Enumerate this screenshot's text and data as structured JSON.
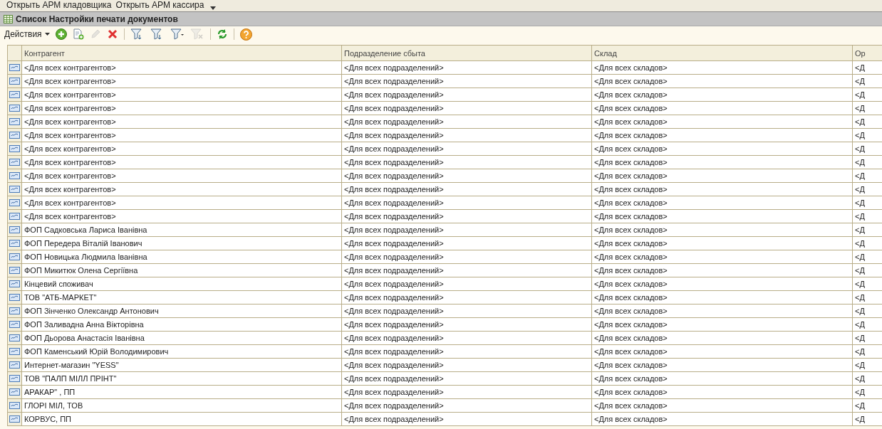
{
  "top_bar": {
    "buttons": [
      "Открыть АРМ кладовщика",
      "Открыть АРМ кассира"
    ]
  },
  "window": {
    "title": "Список Настройки печати документов"
  },
  "toolbar": {
    "actions_label": "Действия",
    "tools": [
      {
        "kind": "add",
        "disabled": false
      },
      {
        "kind": "copy",
        "disabled": false
      },
      {
        "kind": "edit",
        "disabled": true
      },
      {
        "kind": "delete",
        "disabled": false
      },
      {
        "kind": "sep"
      },
      {
        "kind": "filter-set",
        "disabled": false
      },
      {
        "kind": "filter-value",
        "disabled": false
      },
      {
        "kind": "filter-history",
        "disabled": false
      },
      {
        "kind": "filter-clear",
        "disabled": true
      },
      {
        "kind": "sep"
      },
      {
        "kind": "refresh",
        "disabled": false
      },
      {
        "kind": "sep"
      },
      {
        "kind": "help",
        "disabled": false
      }
    ]
  },
  "table": {
    "columns": [
      "Контрагент",
      "Подразделение сбыта",
      "Склад",
      "Ор"
    ],
    "rows": [
      [
        "<Для всех контрагентов>",
        "<Для всех подразделений>",
        "<Для всех складов>",
        "<Д"
      ],
      [
        "<Для всех контрагентов>",
        "<Для всех подразделений>",
        "<Для всех складов>",
        "<Д"
      ],
      [
        "<Для всех контрагентов>",
        "<Для всех подразделений>",
        "<Для всех складов>",
        "<Д"
      ],
      [
        "<Для всех контрагентов>",
        "<Для всех подразделений>",
        "<Для всех складов>",
        "<Д"
      ],
      [
        "<Для всех контрагентов>",
        "<Для всех подразделений>",
        "<Для всех складов>",
        "<Д"
      ],
      [
        "<Для всех контрагентов>",
        "<Для всех подразделений>",
        "<Для всех складов>",
        "<Д"
      ],
      [
        "<Для всех контрагентов>",
        "<Для всех подразделений>",
        "<Для всех складов>",
        "<Д"
      ],
      [
        "<Для всех контрагентов>",
        "<Для всех подразделений>",
        "<Для всех складов>",
        "<Д"
      ],
      [
        "<Для всех контрагентов>",
        "<Для всех подразделений>",
        "<Для всех складов>",
        "<Д"
      ],
      [
        "<Для всех контрагентов>",
        "<Для всех подразделений>",
        "<Для всех складов>",
        "<Д"
      ],
      [
        "<Для всех контрагентов>",
        "<Для всех подразделений>",
        "<Для всех складов>",
        "<Д"
      ],
      [
        "<Для всех контрагентов>",
        "<Для всех подразделений>",
        "<Для всех складов>",
        "<Д"
      ],
      [
        "ФОП Садковська Лариса Іванівна",
        "<Для всех подразделений>",
        "<Для всех складов>",
        "<Д"
      ],
      [
        "ФОП Передера Віталій Іванович",
        "<Для всех подразделений>",
        "<Для всех складов>",
        "<Д"
      ],
      [
        "ФОП Новицька Людмила Іванівна",
        "<Для всех подразделений>",
        "<Для всех складов>",
        "<Д"
      ],
      [
        "ФОП Микитюк Олена Сергіївна",
        "<Для всех подразделений>",
        "<Для всех складов>",
        "<Д"
      ],
      [
        "Кінцевий споживач",
        "<Для всех подразделений>",
        "<Для всех складов>",
        "<Д"
      ],
      [
        "ТОВ \"АТБ-МАРКЕТ\"",
        "<Для всех подразделений>",
        "<Для всех складов>",
        "<Д"
      ],
      [
        "ФОП Зінченко Олександр Антонович",
        "<Для всех подразделений>",
        "<Для всех складов>",
        "<Д"
      ],
      [
        "ФОП Заливадна Анна Вікторівна",
        "<Для всех подразделений>",
        "<Для всех складов>",
        "<Д"
      ],
      [
        "ФОП Дьорова Анастасія Іванівна",
        "<Для всех подразделений>",
        "<Для всех складов>",
        "<Д"
      ],
      [
        "ФОП Каменський Юрій Володимирович",
        "<Для всех подразделений>",
        "<Для всех складов>",
        "<Д"
      ],
      [
        "Интернет-магазин \"YESS\"",
        "<Для всех подразделений>",
        "<Для всех складов>",
        "<Д"
      ],
      [
        "ТОВ \"ПАЛП МІЛЛ ПРІНТ\"",
        "<Для всех подразделений>",
        "<Для всех складов>",
        "<Д"
      ],
      [
        "АРАКАР\"  , ПП",
        "<Для всех подразделений>",
        "<Для всех складов>",
        "<Д"
      ],
      [
        "ГЛОРІ МІЛ, ТОВ",
        "<Для всех подразделений>",
        "<Для всех складов>",
        "<Д"
      ],
      [
        "КОРВУС, ПП",
        "<Для всех подразделений>",
        "<Для всех складов>",
        "<Д"
      ]
    ]
  }
}
